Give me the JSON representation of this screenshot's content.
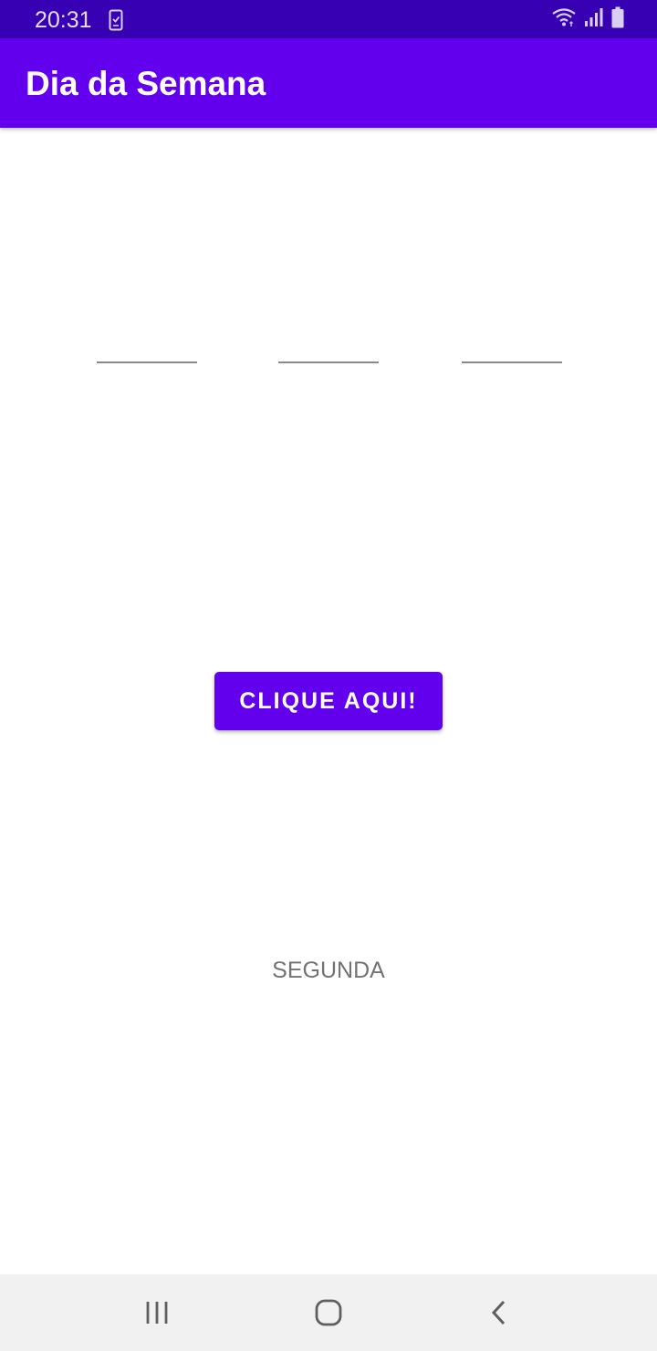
{
  "status_bar": {
    "time": "20:31",
    "icons": [
      "phone-notification-icon",
      "wifi-icon",
      "signal-icon",
      "battery-icon"
    ]
  },
  "app_bar": {
    "title": "Dia da Semana"
  },
  "form": {
    "field_1_value": "",
    "field_2_value": "",
    "field_3_value": ""
  },
  "main": {
    "button_label": "CLIQUE AQUI!",
    "result_text": "SEGUNDA"
  },
  "nav_bar": {
    "icons": [
      "recents-icon",
      "home-icon",
      "back-icon"
    ]
  },
  "colors": {
    "primary": "#6200ee",
    "primary_dark": "#3700b3",
    "result_text": "#737373"
  }
}
